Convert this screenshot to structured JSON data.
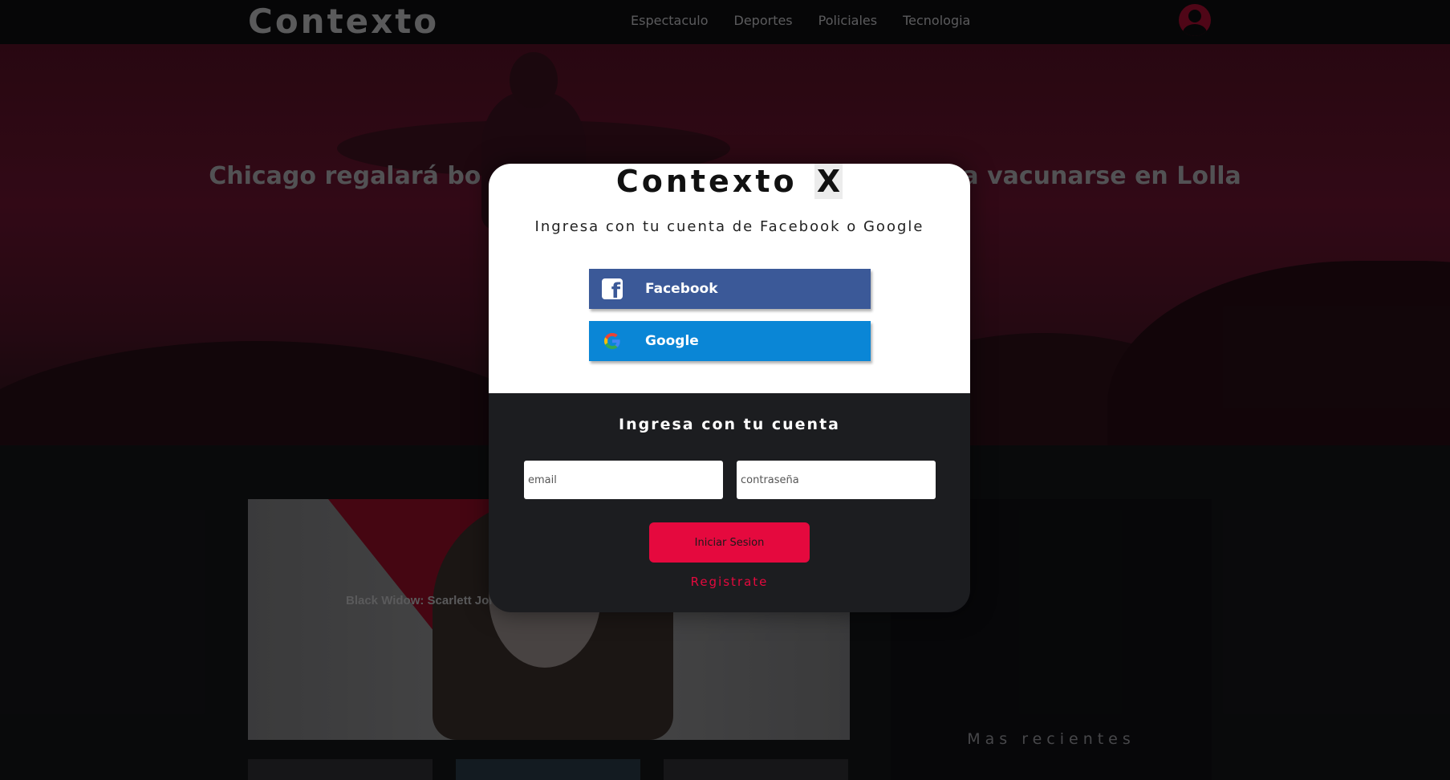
{
  "app": {
    "brand": "Contexto",
    "nav": [
      "Espectaculo",
      "Deportes",
      "Policiales",
      "Tecnologia"
    ],
    "user_icon": "user-circle-icon"
  },
  "hero": {
    "title": "Chicago regalará bo... a vacunarse en Lolla",
    "title_left": "Chicago regalará bo",
    "title_right": "a vacunarse en Lolla"
  },
  "feature": {
    "title": "Black Widow: Scarlett Joha"
  },
  "side": {
    "title": "Mas recientes"
  },
  "modal": {
    "title": "Contexto",
    "close_label": "X",
    "subtitle": "Ingresa con tu cuenta de Facebook o Google",
    "facebook_label": "Facebook",
    "google_label": "Google",
    "account_title": "Ingresa con tu cuenta",
    "email_placeholder": "email",
    "password_placeholder": "contraseña",
    "login_label": "Iniciar Sesion",
    "register_label": "Registrate"
  },
  "colors": {
    "accent": "#e5093e",
    "facebook": "#3b5998",
    "google": "#0a86d6",
    "topbar": "#0a0a0b"
  }
}
